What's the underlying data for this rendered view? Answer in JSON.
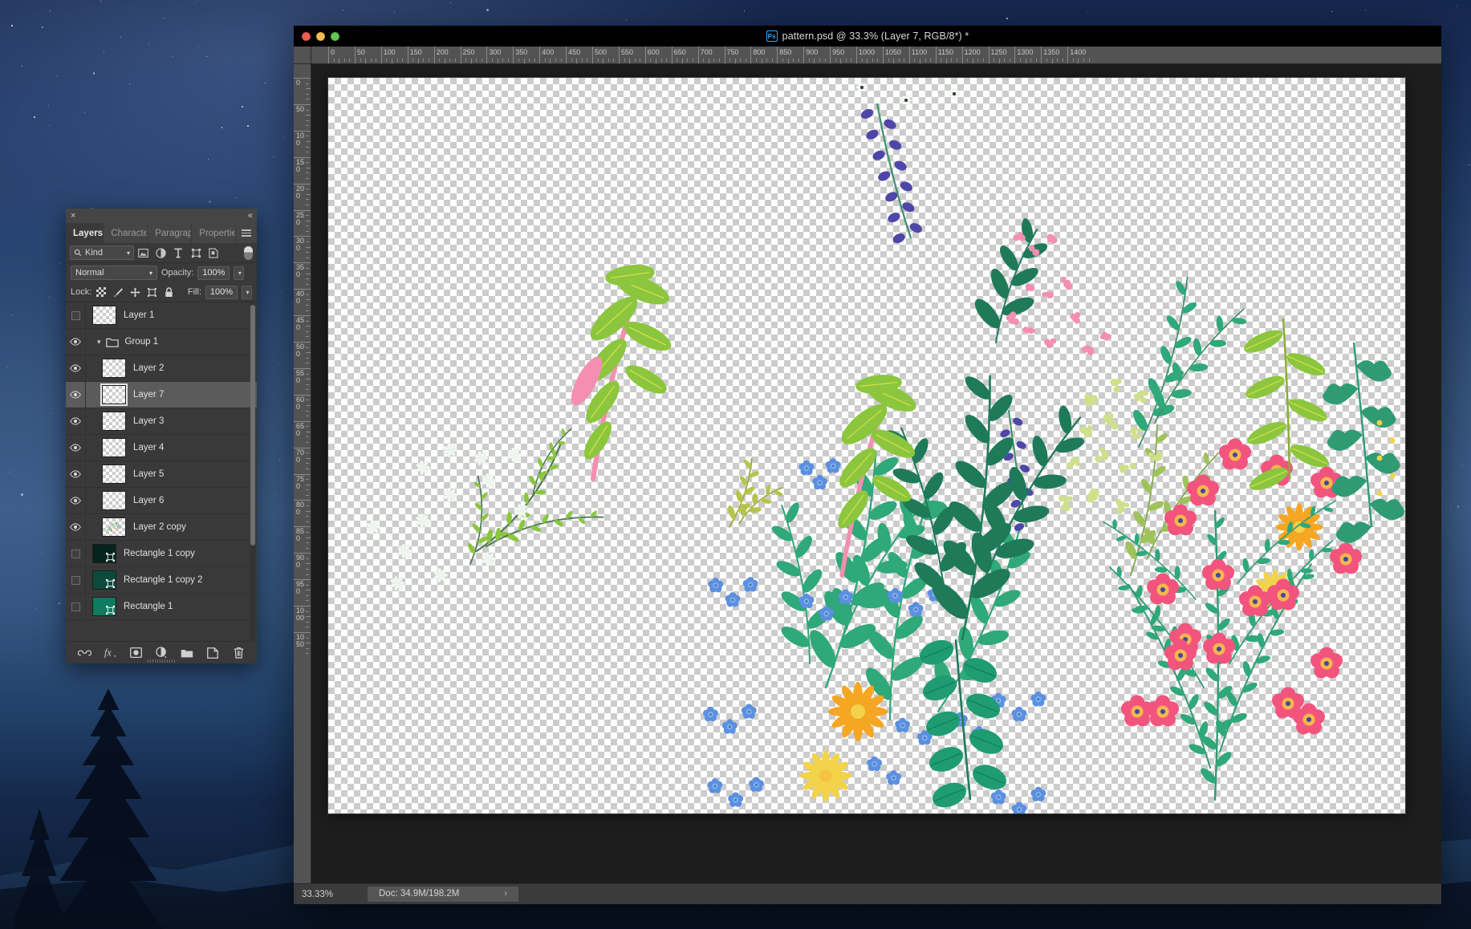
{
  "window": {
    "title": "pattern.psd @ 33.3% (Layer 7, RGB/8*) *",
    "app_badge": "Ps",
    "traffic_lights": [
      "close",
      "minimize",
      "zoom"
    ]
  },
  "rulers": {
    "horizontal_labels": [
      "0",
      "50",
      "100",
      "150",
      "200",
      "250",
      "300",
      "350",
      "400",
      "450",
      "500",
      "550",
      "600",
      "650",
      "700",
      "750",
      "800",
      "850",
      "900",
      "950",
      "1000",
      "1050",
      "1100",
      "1150",
      "1200",
      "1250",
      "1300",
      "1350",
      "1400"
    ],
    "vertical_labels": [
      "0",
      "50",
      "100",
      "150",
      "200",
      "250",
      "300",
      "350",
      "400",
      "450",
      "500",
      "550",
      "600",
      "650",
      "700",
      "750",
      "800",
      "850",
      "900",
      "950",
      "1000",
      "1050"
    ],
    "units_step": 50
  },
  "statusbar": {
    "zoom": "33.33%",
    "doc_info": "Doc: 34.9M/198.2M",
    "arrow": "›"
  },
  "layers_panel": {
    "close_glyph": "×",
    "collapse_glyph": "«",
    "tabs": [
      {
        "label": "Layers",
        "active": true
      },
      {
        "label": "Characte",
        "active": false
      },
      {
        "label": "Paragrap",
        "active": false
      },
      {
        "label": "Propertie",
        "active": false
      }
    ],
    "menu_icon": "hamburger-menu-icon",
    "filter": {
      "kind_label": "Kind",
      "search_icon": "search-icon",
      "icons": [
        "pixel-layer-filter-icon",
        "adjustment-layer-filter-icon",
        "type-layer-filter-icon",
        "shape-layer-filter-icon",
        "smart-object-filter-icon"
      ],
      "toggle_name": "filter-enable-toggle"
    },
    "blend": {
      "mode": "Normal",
      "opacity_label": "Opacity:",
      "opacity_value": "100%"
    },
    "lock": {
      "label": "Lock:",
      "icons": [
        "lock-transparent-pixels-icon",
        "lock-image-pixels-icon",
        "lock-position-icon",
        "lock-artboard-nesting-icon",
        "lock-all-icon"
      ],
      "fill_label": "Fill:",
      "fill_value": "100%"
    },
    "layers": [
      {
        "name": "Layer 1",
        "visible": false,
        "type": "pixel",
        "indent": 0,
        "selected": false,
        "thumb": "transparent"
      },
      {
        "name": "Group 1",
        "visible": true,
        "type": "group",
        "indent": 0,
        "selected": false,
        "expanded": true
      },
      {
        "name": "Layer 2",
        "visible": true,
        "type": "pixel",
        "indent": 1,
        "selected": false,
        "thumb": "transparent"
      },
      {
        "name": "Layer 7",
        "visible": true,
        "type": "pixel",
        "indent": 1,
        "selected": true,
        "thumb": "transparent"
      },
      {
        "name": "Layer 3",
        "visible": true,
        "type": "pixel",
        "indent": 1,
        "selected": false,
        "thumb": "transparent"
      },
      {
        "name": "Layer 4",
        "visible": true,
        "type": "pixel",
        "indent": 1,
        "selected": false,
        "thumb": "transparent"
      },
      {
        "name": "Layer 5",
        "visible": true,
        "type": "pixel",
        "indent": 1,
        "selected": false,
        "thumb": "transparent"
      },
      {
        "name": "Layer 6",
        "visible": true,
        "type": "pixel",
        "indent": 1,
        "selected": false,
        "thumb": "transparent"
      },
      {
        "name": "Layer 2 copy",
        "visible": true,
        "type": "pixel",
        "indent": 1,
        "selected": false,
        "thumb": "artwork"
      },
      {
        "name": "Rectangle 1 copy",
        "visible": false,
        "type": "shape",
        "indent": 0,
        "selected": false,
        "thumb": "#07231d"
      },
      {
        "name": "Rectangle 1 copy 2",
        "visible": false,
        "type": "shape",
        "indent": 0,
        "selected": false,
        "thumb": "#0d4a3c"
      },
      {
        "name": "Rectangle 1",
        "visible": false,
        "type": "shape",
        "indent": 0,
        "selected": false,
        "thumb": "#0e7a5f"
      }
    ],
    "footer_buttons": [
      "link-layers-icon",
      "layer-style-fx-icon",
      "add-layer-mask-icon",
      "new-adjustment-layer-icon",
      "new-group-icon",
      "new-layer-icon",
      "delete-layer-icon"
    ]
  },
  "artwork": {
    "description": "floral botanical pattern on transparent background",
    "palette": {
      "leaf_green": "#2fa87a",
      "light_green": "#8cc63f",
      "olive": "#b5c44a",
      "pink_flower": "#f2547d",
      "pink_stem": "#f48fb1",
      "blue_flower": "#5b8fe0",
      "purple_bud": "#4e46a8",
      "yellow_flower": "#f5b620",
      "white_flower": "#f4f8f4",
      "pale_green_bloom": "#cfe08a"
    }
  },
  "desktop": {
    "wallpaper": "night-sky-over-mountains"
  }
}
